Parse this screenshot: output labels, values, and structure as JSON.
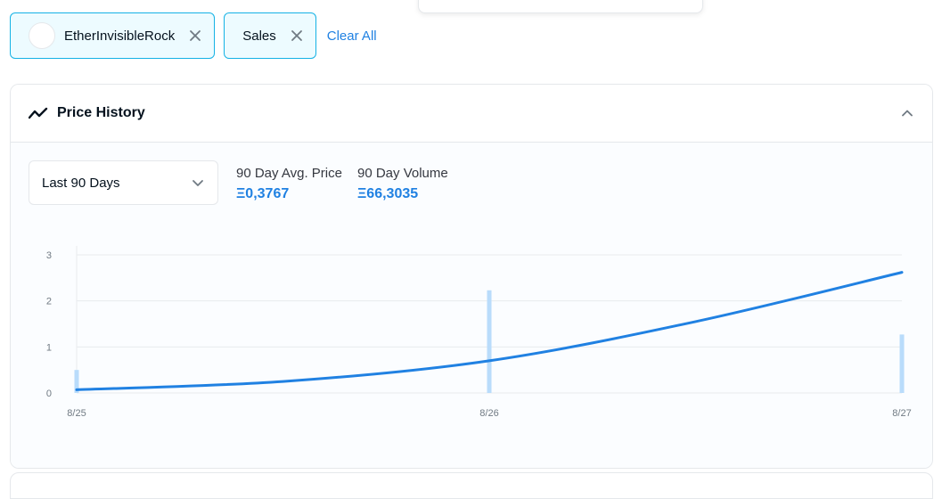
{
  "filters": {
    "collection_label": "EtherInvisibleRock",
    "event_label": "Sales",
    "clear_all_label": "Clear All"
  },
  "panel": {
    "title": "Price History",
    "period_selected": "Last 90 Days",
    "avg_price_label": "90 Day Avg. Price",
    "avg_price_value": "Ξ0,3767",
    "volume_label": "90 Day Volume",
    "volume_value": "Ξ66,3035"
  },
  "colors": {
    "accent": "#2081e2",
    "bar": "#b9dcfb",
    "pill_border": "#15b2e5",
    "pill_bg": "#edfbff"
  },
  "chart_data": {
    "type": "line",
    "x": [
      "8/25",
      "8/26",
      "8/27"
    ],
    "ylim": [
      0,
      3
    ],
    "y_ticks": [
      0,
      1,
      2,
      3
    ],
    "series": [
      {
        "kind": "line",
        "x": [
          0,
          0.5,
          1,
          1.5,
          2
        ],
        "values": [
          0.07,
          0.25,
          0.7,
          1.55,
          2.62
        ]
      },
      {
        "kind": "volume_bars",
        "x": [
          0,
          1,
          2
        ],
        "values": [
          0.5,
          2.23,
          1.27
        ]
      }
    ],
    "grid": true,
    "legend": "none"
  }
}
